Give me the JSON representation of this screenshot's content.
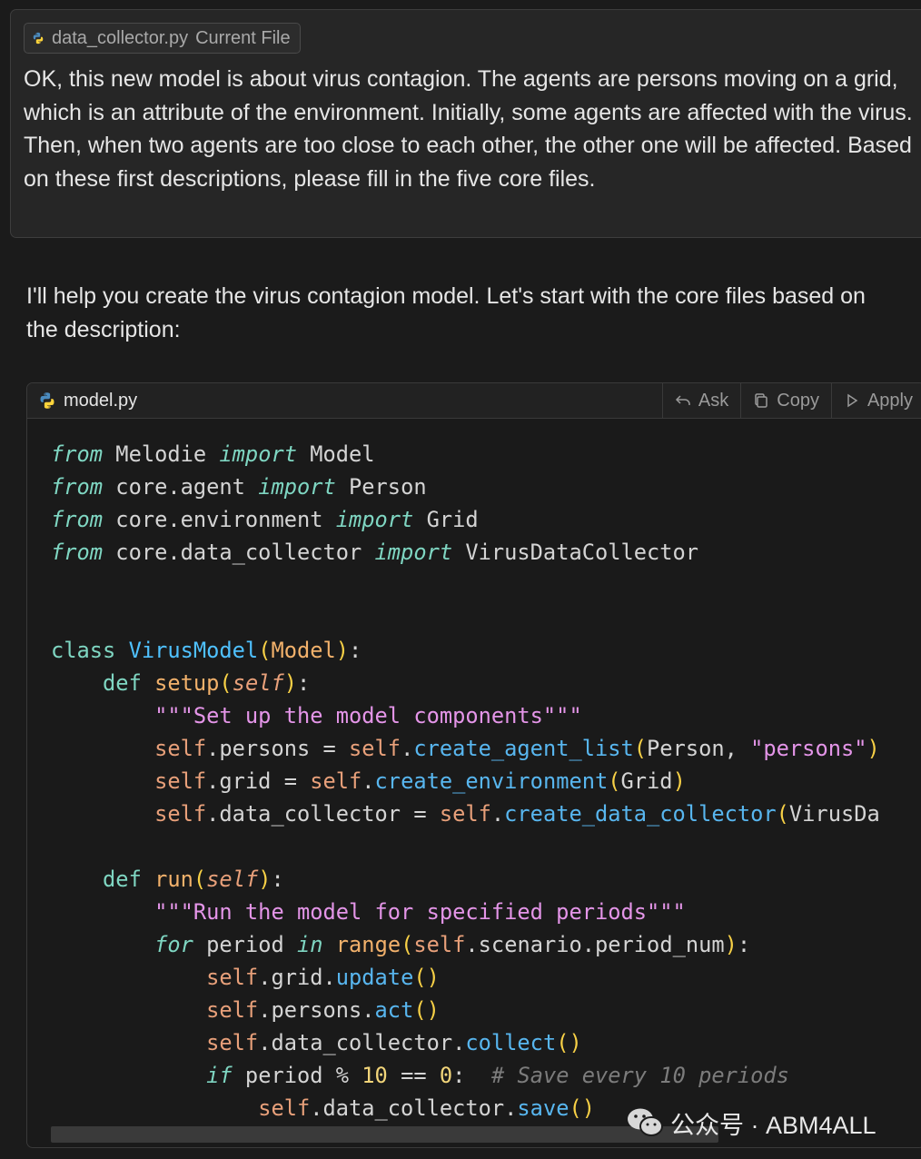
{
  "prompt": {
    "file_chip": {
      "filename": "data_collector.py",
      "label": "Current File"
    },
    "text": "OK, this new model is about virus contagion. The agents are persons moving on a grid, which is an attribute of the environment. Initially, some agents are affected with the virus. Then, when two agents are too close to each other, the other one will be affected. Based on these first descriptions, please fill in the five core files."
  },
  "reply": {
    "text": "I'll help you create the virus contagion model. Let's start with the core files based on the description:"
  },
  "code_block": {
    "filename": "model.py",
    "language_icon": "python-icon",
    "buttons": {
      "ask": "Ask",
      "copy": "Copy",
      "apply": "Apply"
    },
    "code_lines": [
      "from Melodie import Model",
      "from core.agent import Person",
      "from core.environment import Grid",
      "from core.data_collector import VirusDataCollector",
      "",
      "",
      "class VirusModel(Model):",
      "    def setup(self):",
      "        \"\"\"Set up the model components\"\"\"",
      "        self.persons = self.create_agent_list(Person, \"persons\")",
      "        self.grid = self.create_environment(Grid)",
      "        self.data_collector = self.create_data_collector(VirusDa",
      "",
      "    def run(self):",
      "        \"\"\"Run the model for specified periods\"\"\"",
      "        for period in range(self.scenario.period_num):",
      "            self.grid.update()",
      "            self.persons.act()",
      "            self.data_collector.collect()",
      "            if period % 10 == 0:  # Save every 10 periods",
      "                self.data_collector.save()"
    ]
  },
  "watermark": {
    "text": "公众号 · ABM4ALL",
    "icon": "wechat-icon"
  },
  "colors": {
    "background": "#1b1b1b",
    "keyword": "#7fd6c2",
    "class_name": "#4fc1ff",
    "function_name": "#f2b16b",
    "self": "#e8a07a",
    "method": "#58b6ef",
    "string": "#e495e8",
    "number": "#f2d57a",
    "comment": "#7c7c7c",
    "bracket": "#f7d046"
  }
}
